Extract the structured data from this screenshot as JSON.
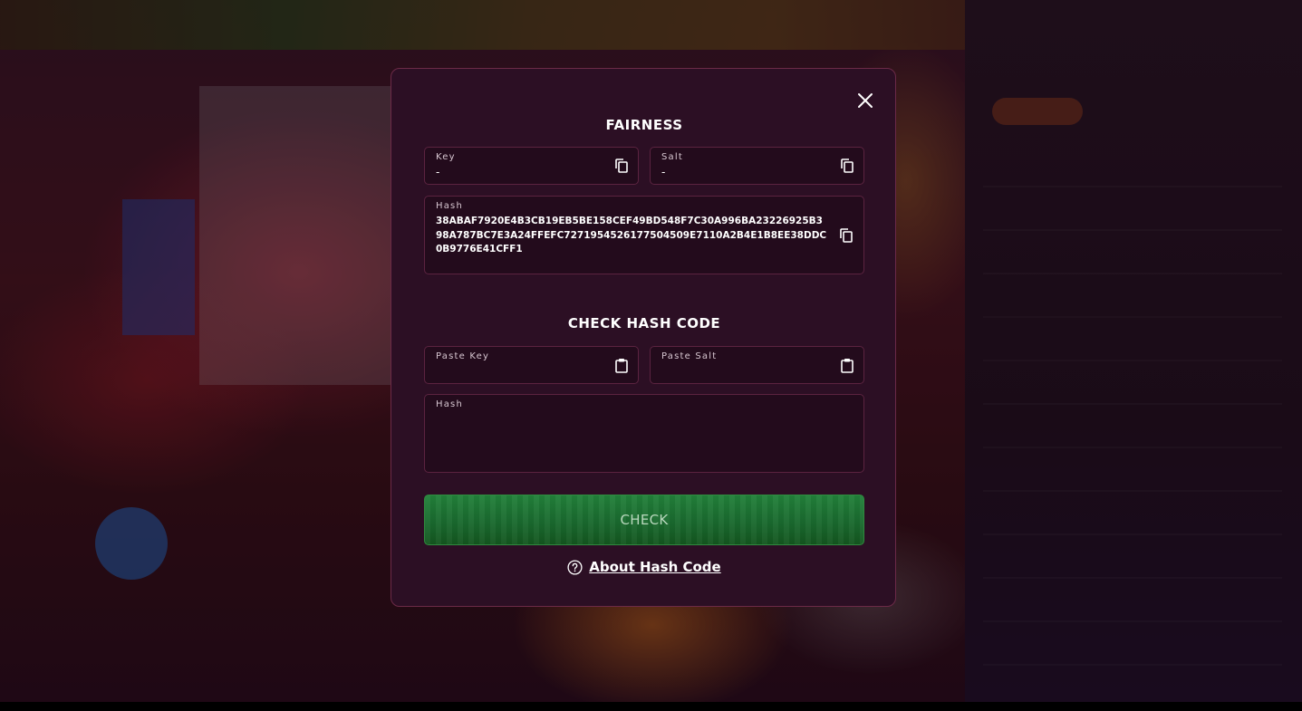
{
  "modal": {
    "fairness": {
      "title": "FAIRNESS",
      "key": {
        "label": "Key",
        "value": "-"
      },
      "salt": {
        "label": "Salt",
        "value": "-"
      },
      "hash": {
        "label": "Hash",
        "value": "38ABAF7920E4B3CB19EB5BE158CEF49BD548F7C30A996BA23226925B398A787BC7E3A24FFEFC7271954526177504509E7110A2B4E1B8EE38DDC0B9776E41CFF1"
      }
    },
    "check": {
      "title": "CHECK HASH CODE",
      "paste_key_label": "Paste Key",
      "paste_salt_label": "Paste Salt",
      "hash_label": "Hash",
      "button_label": "CHECK",
      "about_link": "About Hash Code"
    }
  },
  "icons": {
    "close": "close-icon",
    "copy": "copy-icon",
    "paste": "paste-icon",
    "help": "help-circle-icon"
  },
  "colors": {
    "modal_bg": "#2c0f24",
    "field_bg": "#230b1c",
    "border": "#5b2340",
    "check_button": "#1a6a2f"
  }
}
